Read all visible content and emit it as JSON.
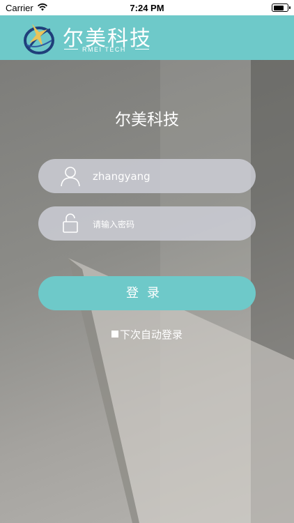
{
  "status_bar": {
    "carrier": "Carrier",
    "time": "7:24 PM",
    "battery_level": 0.8
  },
  "header": {
    "brand_name": "尔美科技",
    "brand_sub": "RMEI TECH",
    "accent_color": "#6ec9c9"
  },
  "login": {
    "title": "尔美科技",
    "username_value": "zhangyang",
    "password_placeholder": "请输入密码",
    "login_button": "登录",
    "auto_login_label": "下次自动登录"
  },
  "icons": {
    "user": "user-icon",
    "lock": "lock-icon",
    "wifi": "wifi-icon",
    "battery": "battery-icon",
    "logo": "logo-icon"
  }
}
